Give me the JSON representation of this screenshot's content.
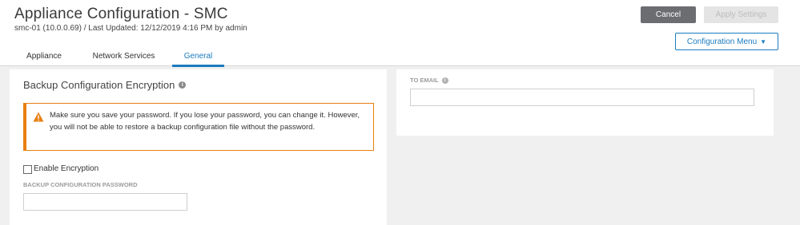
{
  "header": {
    "title": "Appliance Configuration - SMC",
    "subtitle": "smc-01 (10.0.0.69) / Last Updated: 12/12/2019 4:16 PM by admin",
    "cancel_label": "Cancel",
    "apply_label": "Apply Settings",
    "config_menu_label": "Configuration Menu"
  },
  "tabs": [
    {
      "label": "Appliance",
      "active": false
    },
    {
      "label": "Network Services",
      "active": false
    },
    {
      "label": "General",
      "active": true
    }
  ],
  "backup": {
    "section_title": "Backup Configuration Encryption",
    "warning_text": "Make sure you save your password. If you lose your password, you can change it. However, you will not be able to restore a backup configuration file without the password.",
    "enable_encryption_label": "Enable Encryption",
    "enable_encryption_checked": false,
    "password_label": "BACKUP CONFIGURATION PASSWORD",
    "password_value": ""
  },
  "email": {
    "label": "TO EMAIL",
    "value": ""
  },
  "icons": {
    "info": "info-icon",
    "warning": "warning-icon",
    "caret": "caret-down-icon"
  },
  "colors": {
    "accent": "#1a7bbf",
    "warning": "#e97f12",
    "cancel_button": "#6b6d70",
    "disabled_button": "#e4e4e4"
  }
}
